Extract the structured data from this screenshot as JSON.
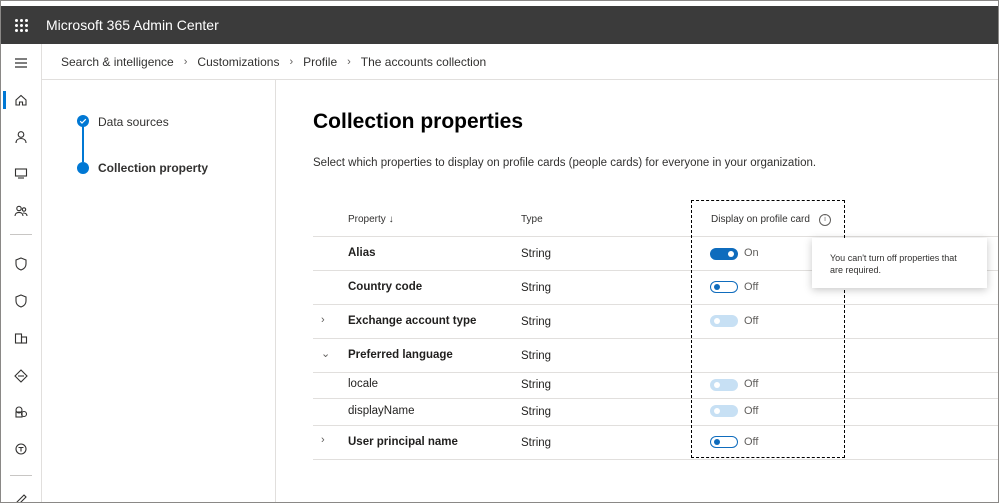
{
  "app": {
    "title": "Microsoft 365 Admin Center"
  },
  "breadcrumb": [
    "Search & intelligence",
    "Customizations",
    "Profile",
    "The accounts collection"
  ],
  "steps": [
    {
      "label": "Data sources",
      "state": "complete"
    },
    {
      "label": "Collection property",
      "state": "current"
    }
  ],
  "page": {
    "title": "Collection properties",
    "description": "Select which properties to display on profile cards (people cards) for everyone in your organization."
  },
  "table": {
    "headers": {
      "property": "Property ↓",
      "type": "Type",
      "display": "Display on profile card"
    },
    "rows": [
      {
        "property": "Alias",
        "type": "String",
        "toggle": "On",
        "state": "on",
        "expander": "",
        "child": false
      },
      {
        "property": "Country code",
        "type": "String",
        "toggle": "Off",
        "state": "off",
        "expander": "",
        "child": false
      },
      {
        "property": "Exchange account type",
        "type": "String",
        "toggle": "Off",
        "state": "disabled",
        "expander": "›",
        "child": false
      },
      {
        "property": "Preferred language",
        "type": "String",
        "toggle": "",
        "state": "none",
        "expander": "⌄",
        "child": false
      },
      {
        "property": "locale",
        "type": "String",
        "toggle": "Off",
        "state": "disabled",
        "expander": "",
        "child": true
      },
      {
        "property": "displayName",
        "type": "String",
        "toggle": "Off",
        "state": "disabled",
        "expander": "",
        "child": true
      },
      {
        "property": "User principal name",
        "type": "String",
        "toggle": "Off",
        "state": "off",
        "expander": "›",
        "child": false
      }
    ]
  },
  "tooltip": {
    "text": "You can't turn off properties that are required.",
    "icon": "info-icon"
  },
  "colors": {
    "accent": "#0078d4",
    "topbar": "#3b3b3b",
    "toggle_disabled": "#c7e0f4"
  }
}
